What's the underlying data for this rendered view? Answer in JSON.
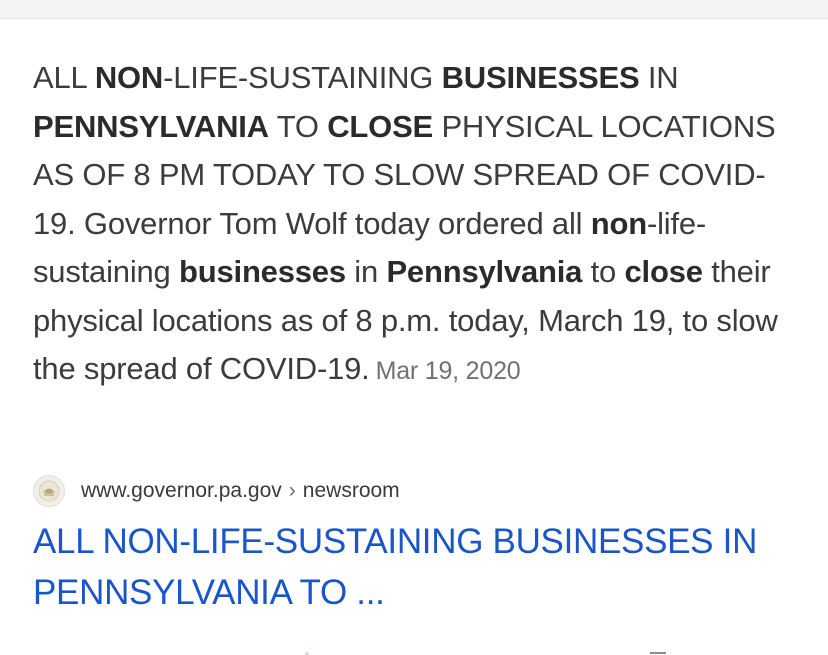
{
  "snippet": {
    "segments": [
      {
        "text": "ALL ",
        "bold": false
      },
      {
        "text": "NON",
        "bold": true
      },
      {
        "text": "-LIFE-SUSTAINING ",
        "bold": false
      },
      {
        "text": "BUSINESSES",
        "bold": true
      },
      {
        "text": " IN ",
        "bold": false
      },
      {
        "text": "PENNSYLVANIA",
        "bold": true
      },
      {
        "text": " TO ",
        "bold": false
      },
      {
        "text": "CLOSE",
        "bold": true
      },
      {
        "text": " PHYSICAL LOCATIONS AS OF 8 PM TODAY TO SLOW SPREAD OF COVID-19. Governor Tom Wolf today ordered all ",
        "bold": false
      },
      {
        "text": "non",
        "bold": true
      },
      {
        "text": "-life-sustaining ",
        "bold": false
      },
      {
        "text": "businesses",
        "bold": true
      },
      {
        "text": " in ",
        "bold": false
      },
      {
        "text": "Pennsylvania",
        "bold": true
      },
      {
        "text": " to ",
        "bold": false
      },
      {
        "text": "close",
        "bold": true
      },
      {
        "text": " their physical locations as of 8 p.m. today, March 19, to slow the spread of COVID-19.",
        "bold": false
      }
    ],
    "date": "Mar 19, 2020"
  },
  "result": {
    "favicon_icon": "pennsylvania-seal-icon",
    "domain": "www.governor.pa.gov",
    "separator": "›",
    "path": "newsroom",
    "title": "ALL NON-LIFE-SUSTAINING BUSINESSES IN PENNSYLVANIA TO ..."
  },
  "colors": {
    "link": "#1a56c9",
    "snippet_text": "#3c3c3e",
    "date_text": "#707075"
  }
}
